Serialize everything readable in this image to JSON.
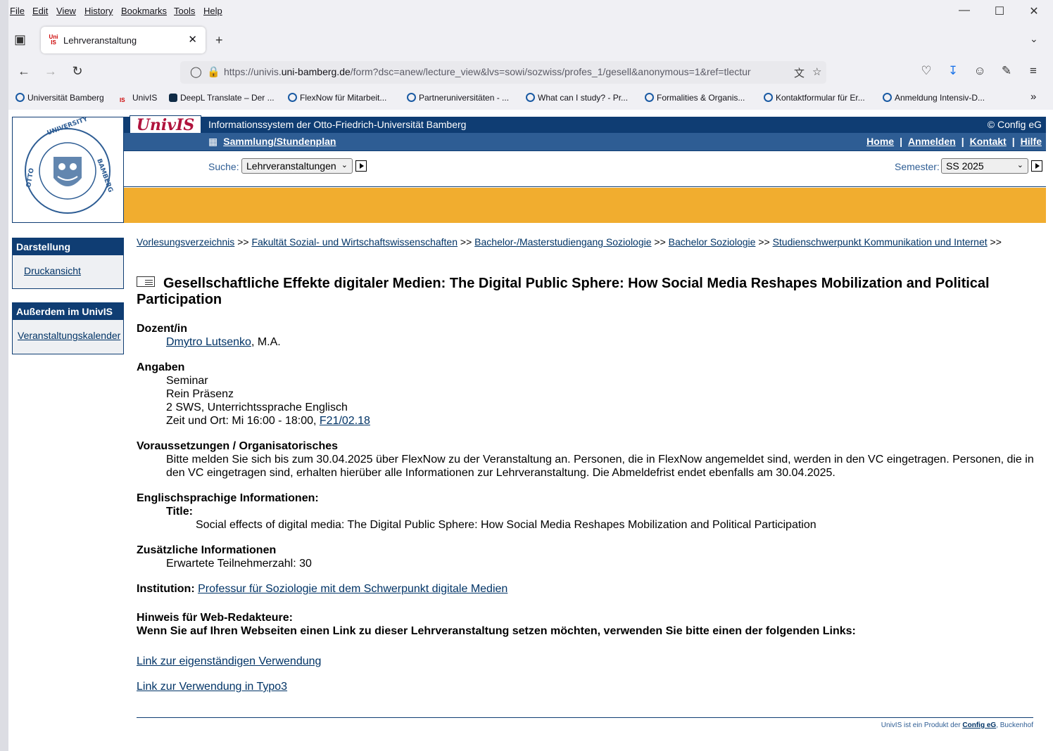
{
  "browser": {
    "menu": [
      "File",
      "Edit",
      "View",
      "History",
      "Bookmarks",
      "Tools",
      "Help"
    ],
    "tab_title": "Lehrveranstaltung",
    "tab_favicon": "UnivIS",
    "url_prefix": "https://univis.",
    "url_domain": "uni-bamberg.de",
    "url_rest": "/form?dsc=anew/lecture_view&lvs=sowi/sozwiss/profes_1/gesell&anonymous=1&ref=tlectur",
    "bookmarks": [
      "Universität Bamberg",
      "UnivIS",
      "DeepL Translate – Der ...",
      "FlexNow für Mitarbeit...",
      "Partneruniversitäten - ...",
      "What can I study? - Pr...",
      "Formalities & Organis...",
      "Kontaktformular für Er...",
      "Anmeldung Intensiv-D..."
    ]
  },
  "header": {
    "logo_text": "UnivIS",
    "site_title": "Informationssystem der Otto-Friedrich-Universität Bamberg",
    "copyright": "© Config eG",
    "sammlung": "Sammlung/Stundenplan",
    "nav": [
      "Home",
      "Anmelden",
      "Kontakt",
      "Hilfe"
    ],
    "search_label": "Suche:",
    "search_value": "Lehrveranstaltungen",
    "semester_label": "Semester:",
    "semester_value": "SS 2025",
    "seal_text": "UNIVERSITY OF BAMBERG"
  },
  "sidebar": {
    "box1_title": "Darstellung",
    "box1_link": "Druckansicht",
    "box2_title": "Außerdem im UnivIS",
    "box2_link": "Veranstaltungskalender"
  },
  "breadcrumb": [
    "Vorlesungsverzeichnis",
    "Fakultät Sozial- und Wirtschaftswissenschaften",
    "Bachelor-/Masterstudiengang Soziologie",
    "Bachelor Soziologie",
    "Studienschwerpunkt Kommunikation und Internet"
  ],
  "breadcrumb_sep": ">>",
  "course": {
    "title": "Gesellschaftliche Effekte digitaler Medien: The Digital Public Sphere: How Social Media Reshapes Mobilization and Political Participation",
    "dozent_label": "Dozent/in",
    "dozent_name": "Dmytro Lutsenko",
    "dozent_suffix": ", M.A.",
    "angaben_label": "Angaben",
    "angaben_1": "Seminar",
    "angaben_2": "Rein Präsenz",
    "angaben_3": "2 SWS, Unterrichtssprache Englisch",
    "angaben_4": "Zeit und Ort: Mi 16:00 - 18:00, ",
    "room": "F21/02.18",
    "vorauss_label": "Voraussetzungen / Organisatorisches",
    "vorauss_text": "Bitte melden Sie sich bis zum 30.04.2025 über FlexNow zu der Veranstaltung an. Personen, die in FlexNow angemeldet sind, werden in den VC eingetragen. Personen, die in den VC eingetragen sind, erhalten hierüber alle Informationen zur Lehrveranstaltung. Die Abmeldefrist endet ebenfalls am 30.04.2025.",
    "english_label": "Englischsprachige Informationen:",
    "title_label": "Title:",
    "english_title": "Social effects of digital media: The Digital Public Sphere: How Social Media Reshapes Mobilization and Political Participation",
    "zusatz_label": "Zusätzliche Informationen",
    "zusatz_text": "Erwartete Teilnehmerzahl: 30",
    "institution_label": "Institution:",
    "institution": "Professur für Soziologie mit dem Schwerpunkt digitale Medien",
    "hinweis_label": "Hinweis für Web-Redakteure:",
    "hinweis_text": "Wenn Sie auf Ihren Webseiten einen Link zu dieser Lehrveranstaltung setzen möchten, verwenden Sie bitte einen der folgenden Links:",
    "link1": "Link zur eigenständigen Verwendung",
    "link2": "Link zur Verwendung in Typo3"
  },
  "footer": {
    "text": "UnivIS ist ein Produkt der ",
    "link": "Config eG",
    "suffix": ", Buckenhof"
  }
}
